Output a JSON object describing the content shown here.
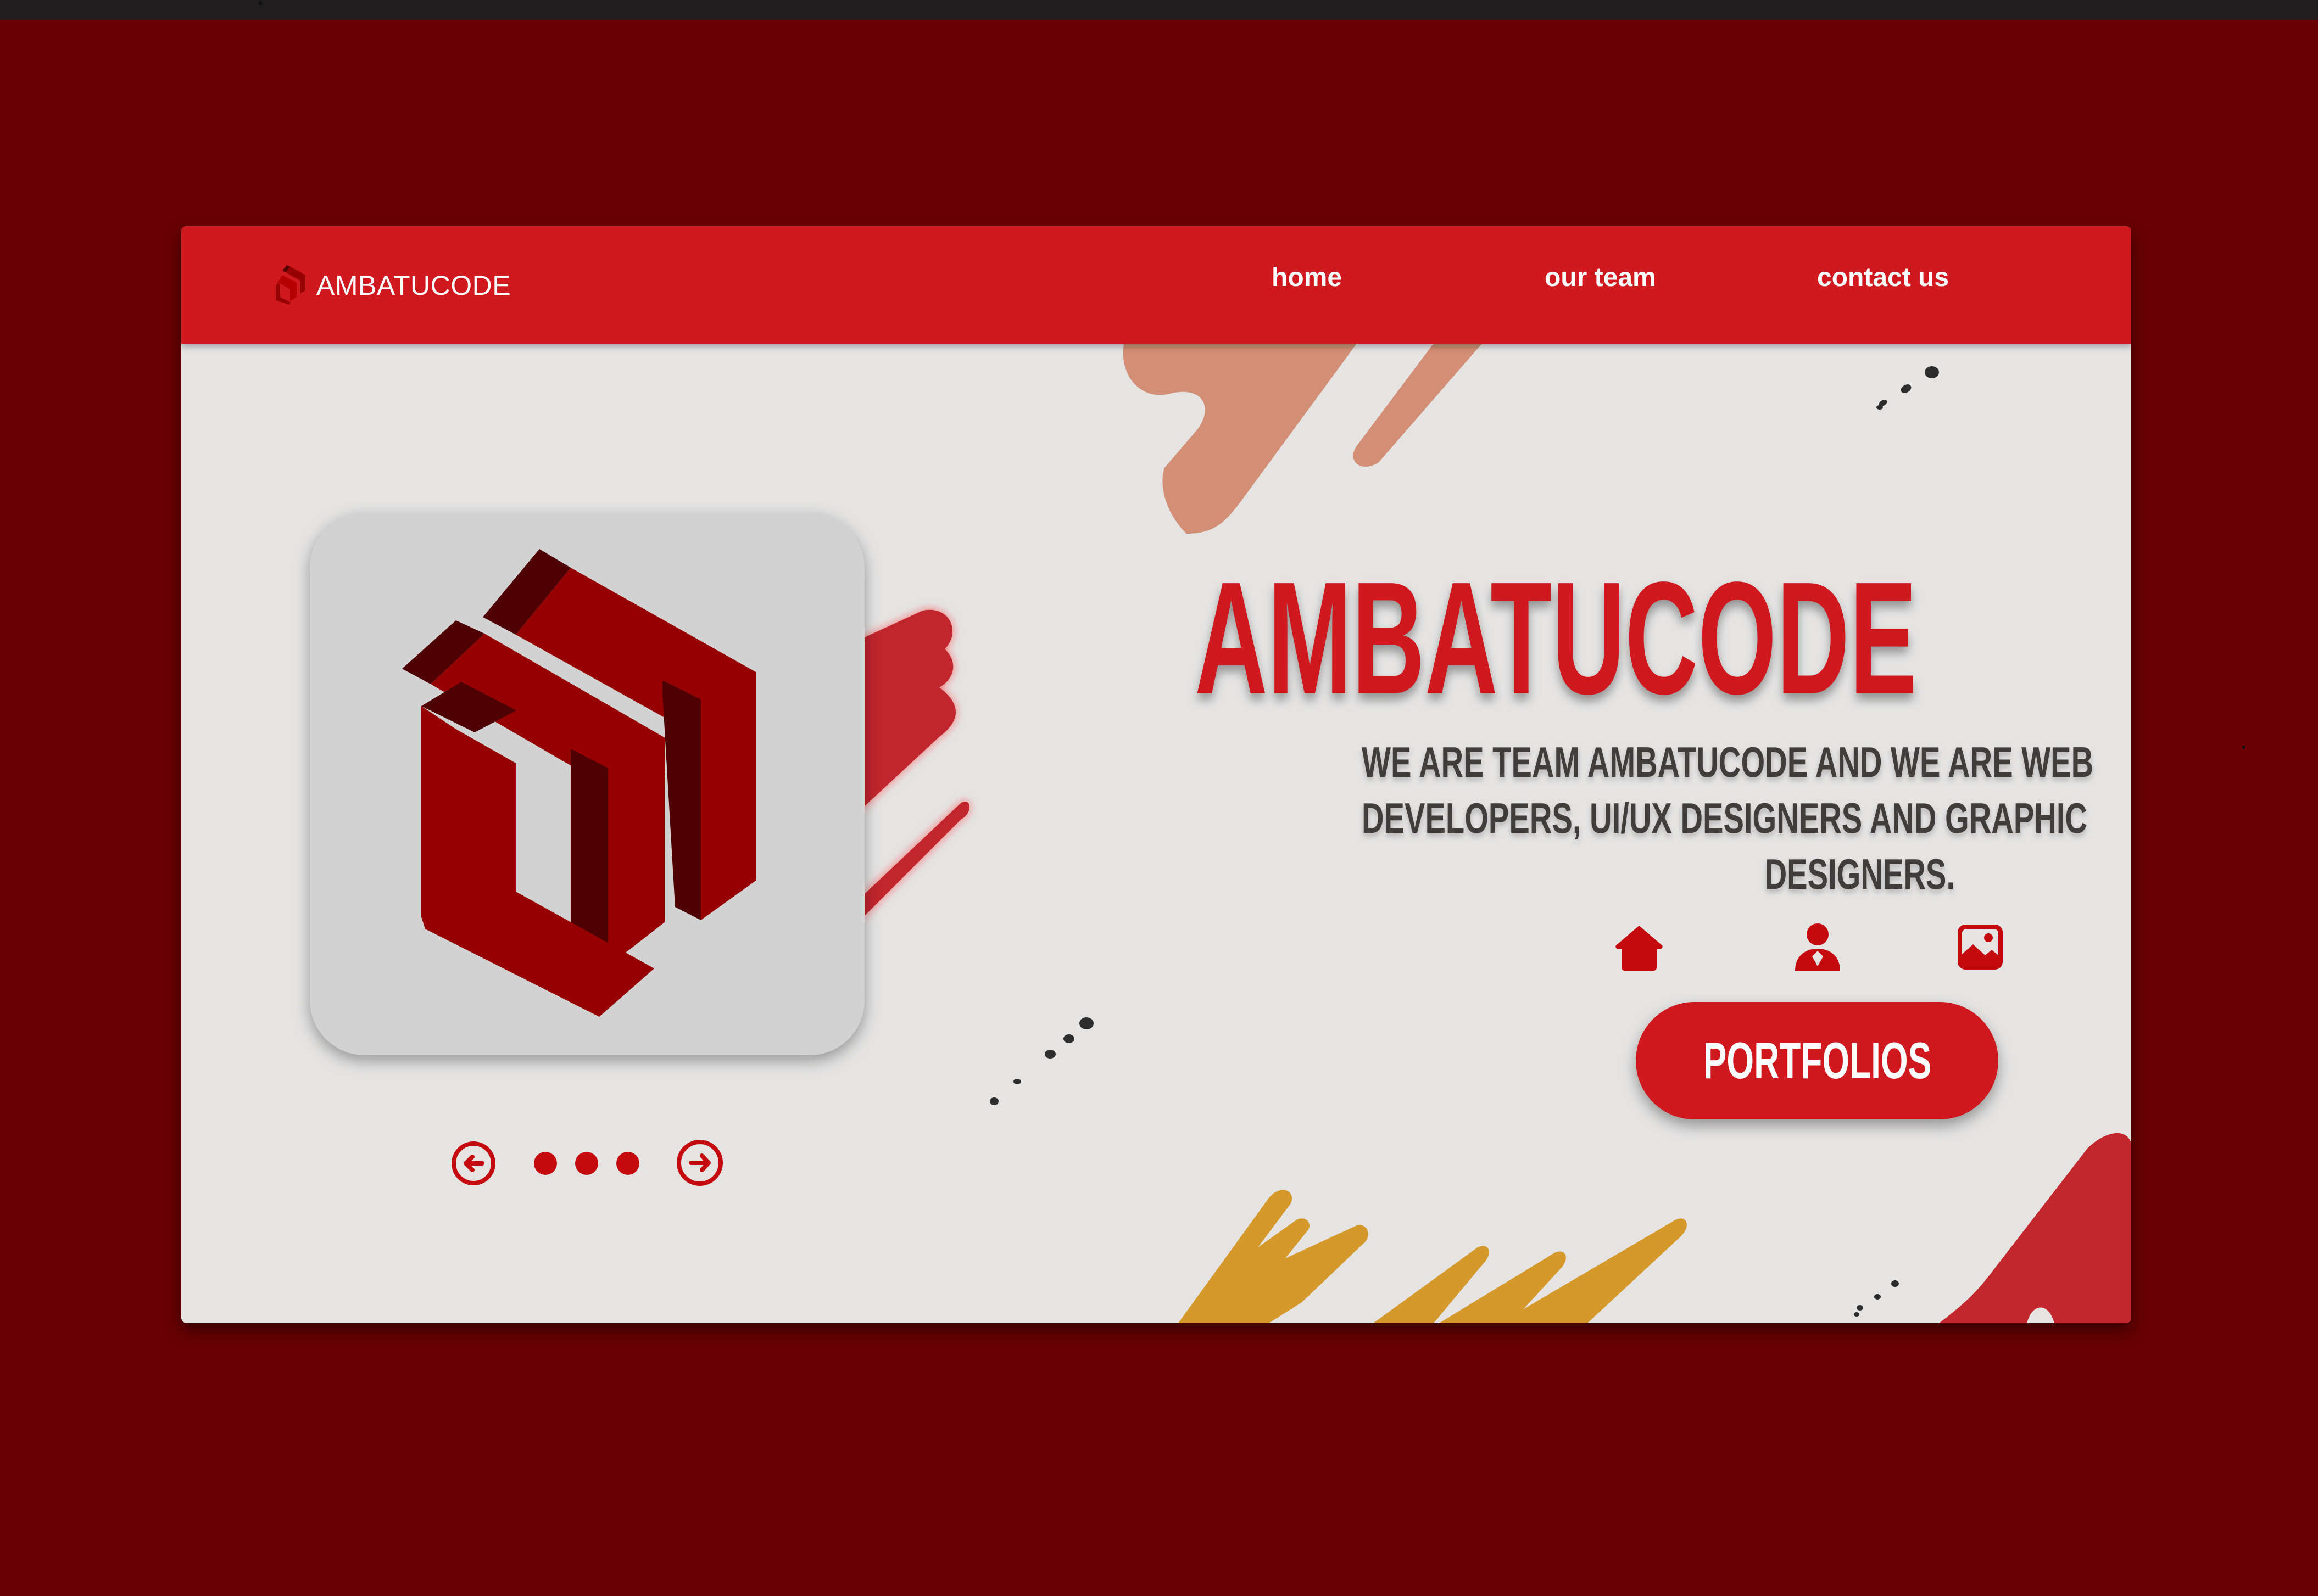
{
  "colors": {
    "page_background": "#680003",
    "nav_background": "#d0181f",
    "card_background": "#e5e4e3",
    "accent_red": "#d0181f",
    "logo_red": "#960000",
    "logo_shadow": "#4e0002",
    "body_text": "#413d3d",
    "salmon_splash": "#d38e76",
    "mustard_splash": "#d4992a"
  },
  "nav": {
    "brand": {
      "icon": "ambatucode-logo-icon",
      "name": "AMBATUCODE"
    },
    "links": [
      {
        "label": "home"
      },
      {
        "label": "our team"
      },
      {
        "label": "contact us"
      }
    ]
  },
  "slider": {
    "prev_icon": "arrow-left-circle-icon",
    "next_icon": "arrow-right-circle-icon",
    "dots": 3
  },
  "hero": {
    "title": "AMBATUCODE",
    "description_lines": [
      "WE ARE TEAM AMBATUCODE AND WE ARE WEB",
      "DEVELOPERS, UI/UX DESIGNERS AND GRAPHIC",
      "DESIGNERS."
    ]
  },
  "icon_links": [
    {
      "icon": "home-icon"
    },
    {
      "icon": "user-icon"
    },
    {
      "icon": "image-icon"
    }
  ],
  "cta": {
    "label": "PORTFOLIOS"
  }
}
